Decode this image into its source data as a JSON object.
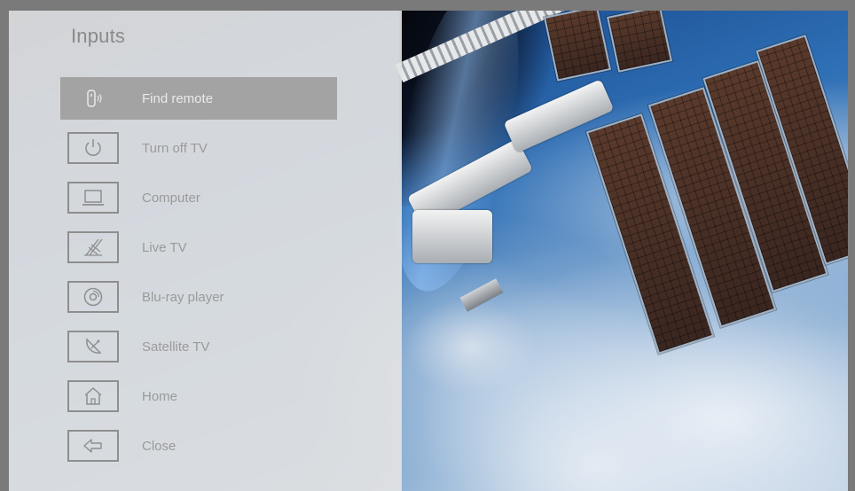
{
  "menu": {
    "title": "Inputs",
    "items": [
      {
        "label": "Find remote",
        "icon": "find-remote-icon",
        "selected": true
      },
      {
        "label": "Turn off TV",
        "icon": "power-icon",
        "selected": false
      },
      {
        "label": "Computer",
        "icon": "laptop-icon",
        "selected": false
      },
      {
        "label": "Live TV",
        "icon": "antenna-icon",
        "selected": false
      },
      {
        "label": "Blu-ray player",
        "icon": "disc-icon",
        "selected": false
      },
      {
        "label": "Satellite TV",
        "icon": "satellite-dish-icon",
        "selected": false
      },
      {
        "label": "Home",
        "icon": "home-icon",
        "selected": false
      },
      {
        "label": "Close",
        "icon": "back-arrow-icon",
        "selected": false
      }
    ]
  },
  "colors": {
    "panel_bg": "#e2e2e2",
    "selected_bg": "#a3a3a3",
    "text": "#9a9a9a",
    "selected_text": "#e9e9e9"
  },
  "background": {
    "description_icon": "space-station-over-earth"
  }
}
